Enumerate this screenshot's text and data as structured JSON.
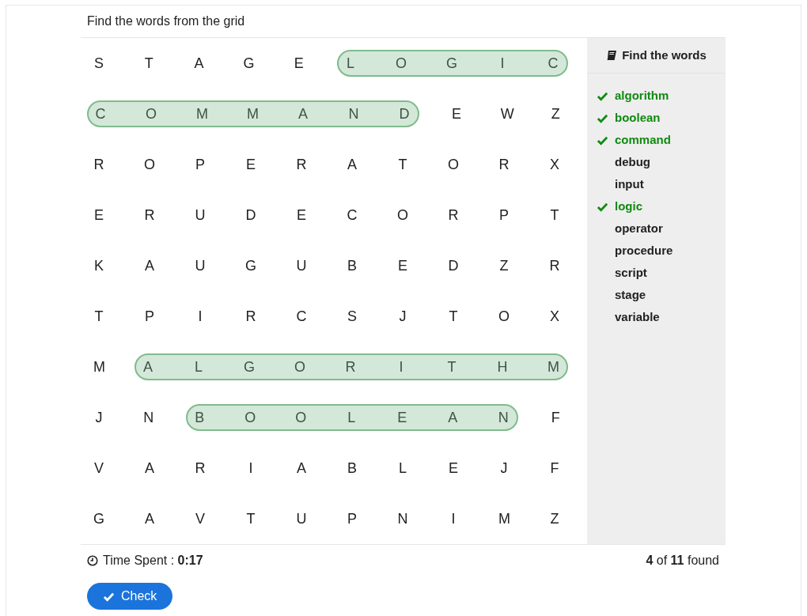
{
  "title": "Find the words from the grid",
  "grid": [
    {
      "segments": [
        {
          "kind": "plain",
          "letters": [
            "S",
            "T",
            "A",
            "G",
            "E"
          ]
        },
        {
          "kind": "found",
          "letters": [
            "L",
            "O",
            "G",
            "I",
            "C"
          ]
        }
      ]
    },
    {
      "segments": [
        {
          "kind": "found",
          "letters": [
            "C",
            "O",
            "M",
            "M",
            "A",
            "N",
            "D"
          ]
        },
        {
          "kind": "plain",
          "letters": [
            "E",
            "W",
            "Z"
          ]
        }
      ]
    },
    {
      "segments": [
        {
          "kind": "plain",
          "letters": [
            "R",
            "O",
            "P",
            "E",
            "R",
            "A",
            "T",
            "O",
            "R",
            "X"
          ]
        }
      ]
    },
    {
      "segments": [
        {
          "kind": "plain",
          "letters": [
            "E",
            "R",
            "U",
            "D",
            "E",
            "C",
            "O",
            "R",
            "P",
            "T"
          ]
        }
      ]
    },
    {
      "segments": [
        {
          "kind": "plain",
          "letters": [
            "K",
            "A",
            "U",
            "G",
            "U",
            "B",
            "E",
            "D",
            "Z",
            "R"
          ]
        }
      ]
    },
    {
      "segments": [
        {
          "kind": "plain",
          "letters": [
            "T",
            "P",
            "I",
            "R",
            "C",
            "S",
            "J",
            "T",
            "O",
            "X"
          ]
        }
      ]
    },
    {
      "segments": [
        {
          "kind": "plain",
          "letters": [
            "M"
          ]
        },
        {
          "kind": "found",
          "letters": [
            "A",
            "L",
            "G",
            "O",
            "R",
            "I",
            "T",
            "H",
            "M"
          ]
        }
      ]
    },
    {
      "segments": [
        {
          "kind": "plain",
          "letters": [
            "J",
            "N"
          ]
        },
        {
          "kind": "found",
          "letters": [
            "B",
            "O",
            "O",
            "L",
            "E",
            "A",
            "N"
          ]
        },
        {
          "kind": "plain",
          "letters": [
            "F"
          ]
        }
      ]
    },
    {
      "segments": [
        {
          "kind": "plain",
          "letters": [
            "V",
            "A",
            "R",
            "I",
            "A",
            "B",
            "L",
            "E",
            "J",
            "F"
          ]
        }
      ]
    },
    {
      "segments": [
        {
          "kind": "plain",
          "letters": [
            "G",
            "A",
            "V",
            "T",
            "U",
            "P",
            "N",
            "I",
            "M",
            "Z"
          ]
        }
      ]
    }
  ],
  "word_list": {
    "title": "Find the words",
    "words": [
      {
        "word": "algorithm",
        "found": true
      },
      {
        "word": "boolean",
        "found": true
      },
      {
        "word": "command",
        "found": true
      },
      {
        "word": "debug",
        "found": false
      },
      {
        "word": "input",
        "found": false
      },
      {
        "word": "logic",
        "found": true
      },
      {
        "word": "operator",
        "found": false
      },
      {
        "word": "procedure",
        "found": false
      },
      {
        "word": "script",
        "found": false
      },
      {
        "word": "stage",
        "found": false
      },
      {
        "word": "variable",
        "found": false
      }
    ]
  },
  "time_label": "Time Spent : ",
  "time_value": "0:17",
  "found_count": "**4** of **11** found",
  "check_button": "Check"
}
